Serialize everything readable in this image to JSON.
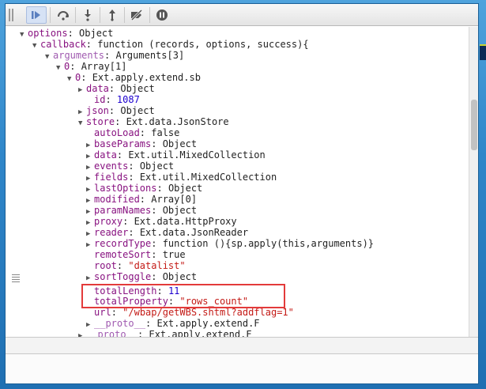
{
  "toolbar": {
    "buttons": [
      "resume-icon",
      "step-over-icon",
      "step-into-icon",
      "step-out-icon",
      "deactivate-breakpoints-icon",
      "pause-icon"
    ]
  },
  "colors": {
    "highlight": "#e33b3b",
    "property_name": "#881280",
    "string_value": "#c41a16",
    "number_value": "#1c00cf"
  },
  "tree": [
    {
      "k": "options",
      "v": "Object",
      "vt": "txt"
    },
    {
      "k": "callback",
      "v": "function (records, options, success){",
      "vt": "txt"
    },
    {
      "k": "arguments",
      "v": "Arguments[3]",
      "vt": "txt"
    },
    {
      "k": "0",
      "v": "Array[1]",
      "vt": "txt"
    },
    {
      "k": "0",
      "v": "Ext.apply.extend.sb",
      "vt": "txt"
    },
    {
      "k": "data",
      "v": "Object",
      "vt": "txt"
    },
    {
      "k": "id",
      "v": "1087",
      "vt": "num"
    },
    {
      "k": "json",
      "v": "Object",
      "vt": "txt"
    },
    {
      "k": "store",
      "v": "Ext.data.JsonStore",
      "vt": "txt"
    },
    {
      "k": "autoLoad",
      "v": "false",
      "vt": "txt"
    },
    {
      "k": "baseParams",
      "v": "Object",
      "vt": "txt"
    },
    {
      "k": "data",
      "v": "Ext.util.MixedCollection",
      "vt": "txt"
    },
    {
      "k": "events",
      "v": "Object",
      "vt": "txt"
    },
    {
      "k": "fields",
      "v": "Ext.util.MixedCollection",
      "vt": "txt"
    },
    {
      "k": "lastOptions",
      "v": "Object",
      "vt": "txt"
    },
    {
      "k": "modified",
      "v": "Array[0]",
      "vt": "txt"
    },
    {
      "k": "paramNames",
      "v": "Object",
      "vt": "txt"
    },
    {
      "k": "proxy",
      "v": "Ext.data.HttpProxy",
      "vt": "txt"
    },
    {
      "k": "reader",
      "v": "Ext.data.JsonReader",
      "vt": "txt"
    },
    {
      "k": "recordType",
      "v": "function (){sp.apply(this,arguments)}",
      "vt": "txt"
    },
    {
      "k": "remoteSort",
      "v": "true",
      "vt": "txt"
    },
    {
      "k": "root",
      "v": "\"datalist\"",
      "vt": "str"
    },
    {
      "k": "sortToggle",
      "v": "Object",
      "vt": "txt"
    },
    {
      "k": "totalLength",
      "v": "11",
      "vt": "num"
    },
    {
      "k": "totalProperty",
      "v": "\"rows_count\"",
      "vt": "str"
    },
    {
      "k": "url",
      "v": "\"/wbap/getWBS.shtml?addflag=1\"",
      "vt": "str"
    },
    {
      "k": "__proto__",
      "v": "Ext.apply.extend.F",
      "vt": "txt"
    },
    {
      "k": "__proto__",
      "v": "Ext.apply.extend.F",
      "vt": "txt"
    }
  ]
}
